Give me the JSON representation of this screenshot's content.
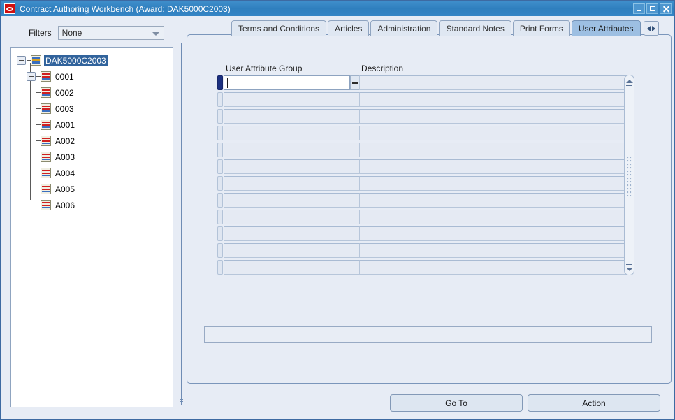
{
  "window": {
    "title": "Contract Authoring Workbench (Award: DAK5000C2003)",
    "app_icon": "oracle-logo-icon",
    "controls": {
      "minimize": "minimize-icon",
      "maximize": "maximize-icon",
      "close": "close-icon"
    },
    "titlebar_color": "#3585c5"
  },
  "filters": {
    "label": "Filters",
    "value": "None",
    "options": [
      "None"
    ]
  },
  "tree": {
    "nodes": [
      {
        "label": "DAK5000C2003",
        "level": 0,
        "toggle": "minus",
        "selected": true
      },
      {
        "label": "0001",
        "level": 1,
        "toggle": "plus",
        "selected": false
      },
      {
        "label": "0002",
        "level": 1,
        "toggle": "none",
        "selected": false
      },
      {
        "label": "0003",
        "level": 1,
        "toggle": "none",
        "selected": false
      },
      {
        "label": "A001",
        "level": 1,
        "toggle": "none",
        "selected": false
      },
      {
        "label": "A002",
        "level": 1,
        "toggle": "none",
        "selected": false
      },
      {
        "label": "A003",
        "level": 1,
        "toggle": "none",
        "selected": false
      },
      {
        "label": "A004",
        "level": 1,
        "toggle": "none",
        "selected": false
      },
      {
        "label": "A005",
        "level": 1,
        "toggle": "none",
        "selected": false
      },
      {
        "label": "A006",
        "level": 1,
        "toggle": "none",
        "selected": false
      }
    ]
  },
  "tabs": {
    "items": [
      {
        "label": "Terms and Conditions",
        "active": false
      },
      {
        "label": "Articles",
        "active": false
      },
      {
        "label": "Administration",
        "active": false
      },
      {
        "label": "Standard Notes",
        "active": false
      },
      {
        "label": "Print Forms",
        "active": false
      },
      {
        "label": "User Attributes",
        "active": true
      }
    ],
    "nav_left_icon": "chevron-left-icon",
    "nav_right_icon": "chevron-right-icon",
    "active_color": "#9dbfe2"
  },
  "grid": {
    "columns": [
      {
        "key": "user_attribute_group",
        "label": "User Attribute Group"
      },
      {
        "key": "description",
        "label": "Description"
      }
    ],
    "rows": [
      {
        "user_attribute_group": "",
        "description": "",
        "active": true
      },
      {
        "user_attribute_group": "",
        "description": "",
        "active": false
      },
      {
        "user_attribute_group": "",
        "description": "",
        "active": false
      },
      {
        "user_attribute_group": "",
        "description": "",
        "active": false
      },
      {
        "user_attribute_group": "",
        "description": "",
        "active": false
      },
      {
        "user_attribute_group": "",
        "description": "",
        "active": false
      },
      {
        "user_attribute_group": "",
        "description": "",
        "active": false
      },
      {
        "user_attribute_group": "",
        "description": "",
        "active": false
      },
      {
        "user_attribute_group": "",
        "description": "",
        "active": false
      },
      {
        "user_attribute_group": "",
        "description": "",
        "active": false
      },
      {
        "user_attribute_group": "",
        "description": "",
        "active": false
      },
      {
        "user_attribute_group": "",
        "description": "",
        "active": false
      }
    ],
    "lov_button_icon": "ellipsis-lov-icon",
    "scrollbar": {
      "up_icon": "scroll-up-arrow-icon",
      "down_icon": "scroll-down-arrow-icon"
    }
  },
  "bottom_field": {
    "value": "",
    "placeholder": ""
  },
  "buttons": {
    "goto": {
      "prefix": "",
      "mnemonic": "G",
      "suffix": "o To"
    },
    "action": {
      "prefix": "Actio",
      "mnemonic": "n",
      "suffix": ""
    }
  }
}
